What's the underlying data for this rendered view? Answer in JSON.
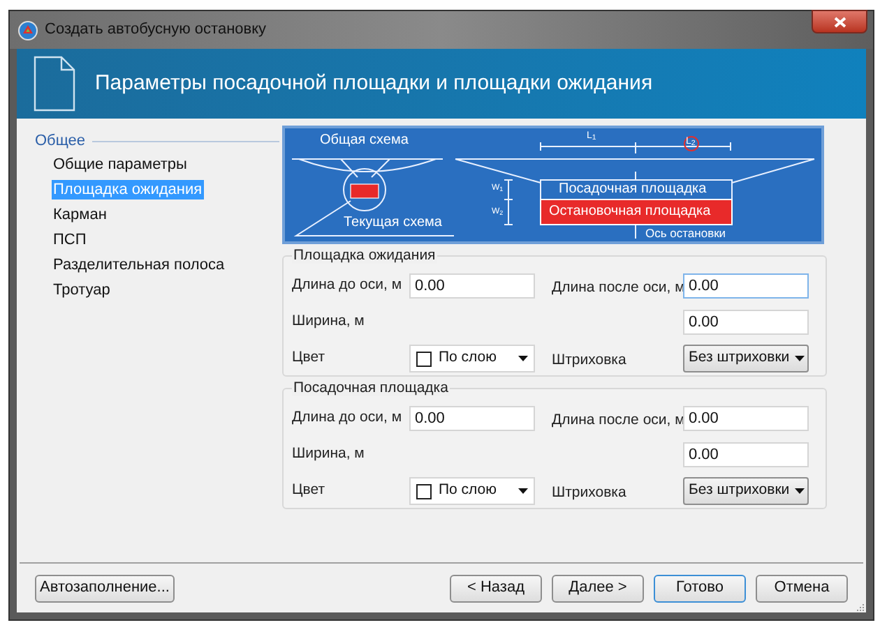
{
  "window": {
    "title": "Создать автобусную остановку"
  },
  "header": {
    "title": "Параметры посадочной площадки и площадки ожидания"
  },
  "sidebar": {
    "group": "Общее",
    "items": [
      {
        "label": "Общие параметры",
        "selected": false
      },
      {
        "label": "Площадка ожидания",
        "selected": true
      },
      {
        "label": "Карман",
        "selected": false
      },
      {
        "label": "ПСП",
        "selected": false
      },
      {
        "label": "Разделительная полоса",
        "selected": false
      },
      {
        "label": "Тротуар",
        "selected": false
      }
    ]
  },
  "diagram": {
    "overview_label": "Общая схема",
    "current_label": "Текущая схема",
    "l1": "L$_{1}$",
    "l2": "L$_{2}$",
    "w1": "W$_{1}$",
    "w2": "W$_{2}$",
    "boarding_label": "Посадочная площадка",
    "stop_label": "Остановочная площадка",
    "axis_label": "Ось остановки"
  },
  "sections": [
    {
      "title": "Площадка ожидания",
      "length_before": {
        "label": "Длина до оси, м",
        "value": "0.00",
        "focused": false
      },
      "length_after": {
        "label": "Длина после оси, м",
        "value": "0.00",
        "focused": true
      },
      "width": {
        "label": "Ширина, м",
        "value": "0.00",
        "focused": false
      },
      "color": {
        "label": "Цвет",
        "value": "По слою"
      },
      "hatch": {
        "label": "Штриховка",
        "value": "Без штриховки"
      }
    },
    {
      "title": "Посадочная площадка",
      "length_before": {
        "label": "Длина до оси, м",
        "value": "0.00",
        "focused": false
      },
      "length_after": {
        "label": "Длина после оси, м",
        "value": "0.00",
        "focused": false
      },
      "width": {
        "label": "Ширина, м",
        "value": "0.00",
        "focused": false
      },
      "color": {
        "label": "Цвет",
        "value": "По слою"
      },
      "hatch": {
        "label": "Штриховка",
        "value": "Без штриховки"
      }
    }
  ],
  "footer": {
    "autofill": "Автозаполнение...",
    "buttons": [
      {
        "label": "< Назад",
        "default": false
      },
      {
        "label": "Далее >",
        "default": false
      },
      {
        "label": "Готово",
        "default": true
      },
      {
        "label": "Отмена",
        "default": false
      }
    ]
  }
}
